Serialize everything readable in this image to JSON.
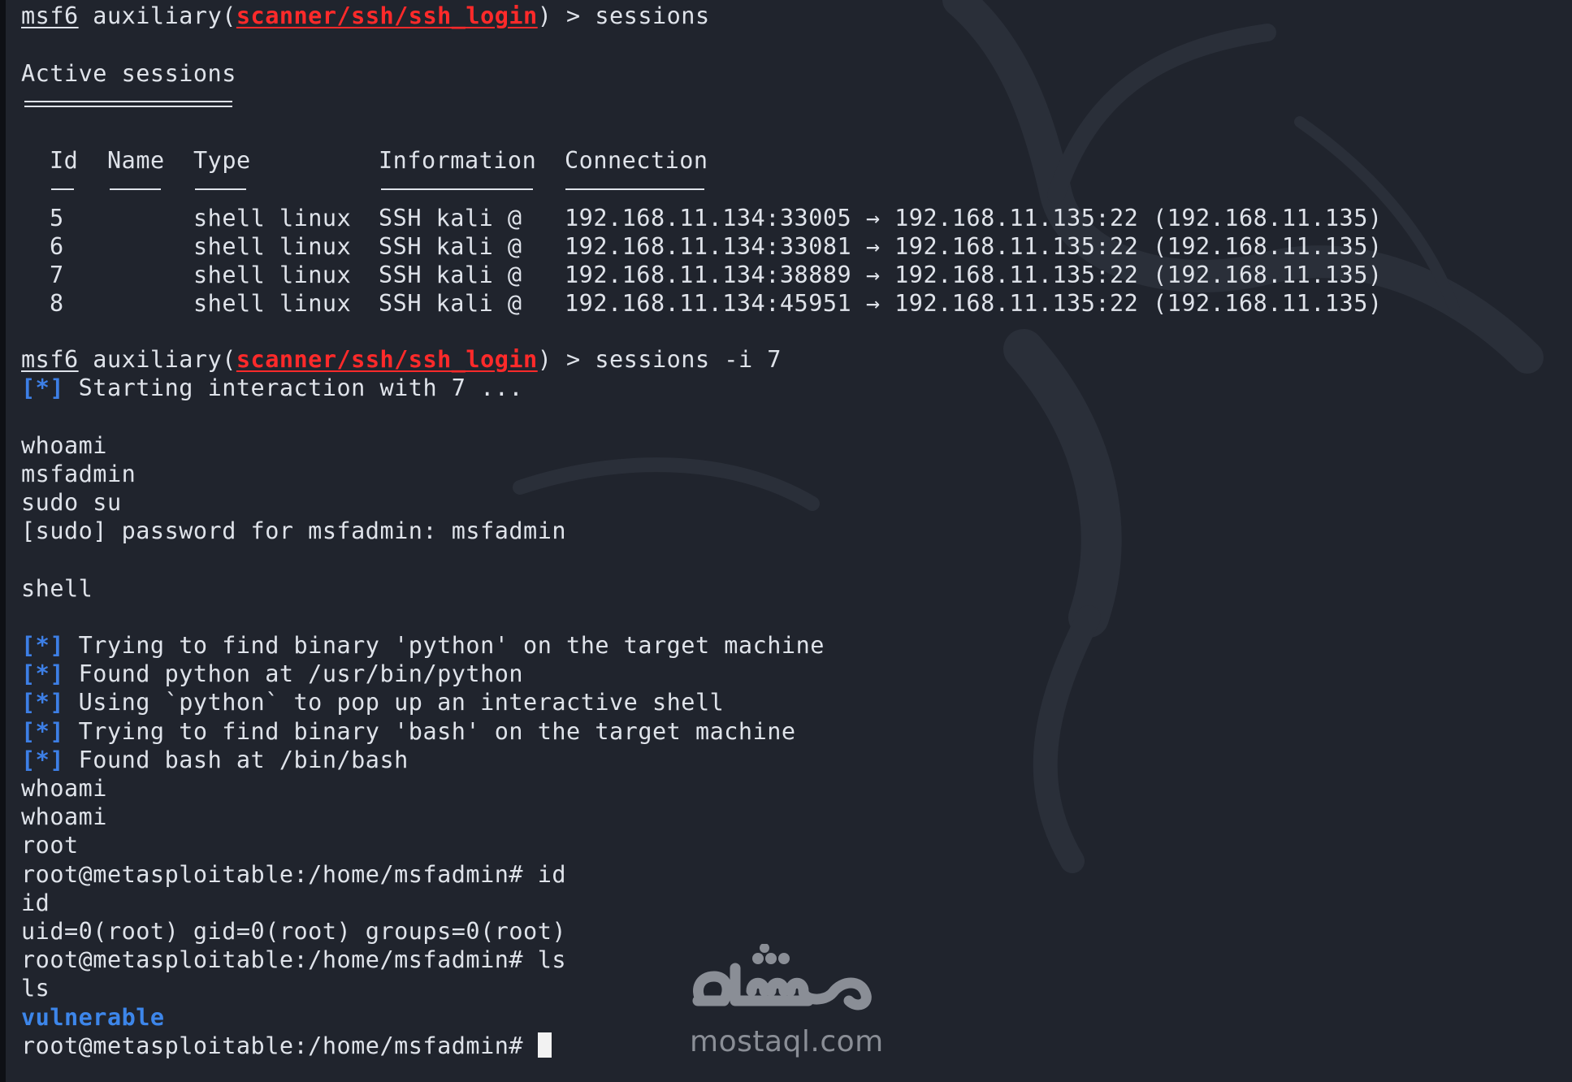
{
  "prompt": {
    "user": "msf6",
    "module_prefix": " auxiliary(",
    "module": "scanner/ssh/ssh_login",
    "module_suffix": ") > "
  },
  "cmd1": "sessions",
  "sessions_title": "Active sessions",
  "table": {
    "headers": [
      "Id",
      "Name",
      "Type",
      "Information",
      "Connection"
    ],
    "rows": [
      {
        "id": "5",
        "name": "",
        "type": "shell linux",
        "info": "SSH kali @",
        "conn": "192.168.11.134:33005 → 192.168.11.135:22 (192.168.11.135)"
      },
      {
        "id": "6",
        "name": "",
        "type": "shell linux",
        "info": "SSH kali @",
        "conn": "192.168.11.134:33081 → 192.168.11.135:22 (192.168.11.135)"
      },
      {
        "id": "7",
        "name": "",
        "type": "shell linux",
        "info": "SSH kali @",
        "conn": "192.168.11.134:38889 → 192.168.11.135:22 (192.168.11.135)"
      },
      {
        "id": "8",
        "name": "",
        "type": "shell linux",
        "info": "SSH kali @",
        "conn": "192.168.11.134:45951 → 192.168.11.135:22 (192.168.11.135)"
      }
    ]
  },
  "cmd2": "sessions -i 7",
  "info_marker": "[*]",
  "starting": " Starting interaction with 7 ...",
  "out": {
    "whoami": "whoami",
    "msfadmin": "msfadmin",
    "sudo": "sudo su",
    "sudo_pw": "[sudo] password for msfadmin: msfadmin",
    "shell": "shell",
    "info1": " Trying to find binary 'python' on the target machine",
    "info2": " Found python at /usr/bin/python",
    "info3": " Using `python` to pop up an interactive shell",
    "info4": " Trying to find binary 'bash' on the target machine",
    "info5": " Found bash at /bin/bash",
    "whoami2": "whoami",
    "whoami3": "whoami",
    "root": "root",
    "root_id": "root@metasploitable:/home/msfadmin# id",
    "id": "id",
    "uid": "uid=0(root) gid=0(root) groups=0(root)",
    "root_ls": "root@metasploitable:/home/msfadmin# ls",
    "ls": "ls",
    "vulnerable": "vulnerable",
    "root_prompt": "root@metasploitable:/home/msfadmin# "
  },
  "watermark": {
    "arabic": "مستقل",
    "latin": "mostaql.com"
  },
  "colors": {
    "background": "#20242d",
    "text": "#dfe3ea",
    "module_red": "#ff2a2a",
    "info_blue": "#3d7fe6"
  }
}
